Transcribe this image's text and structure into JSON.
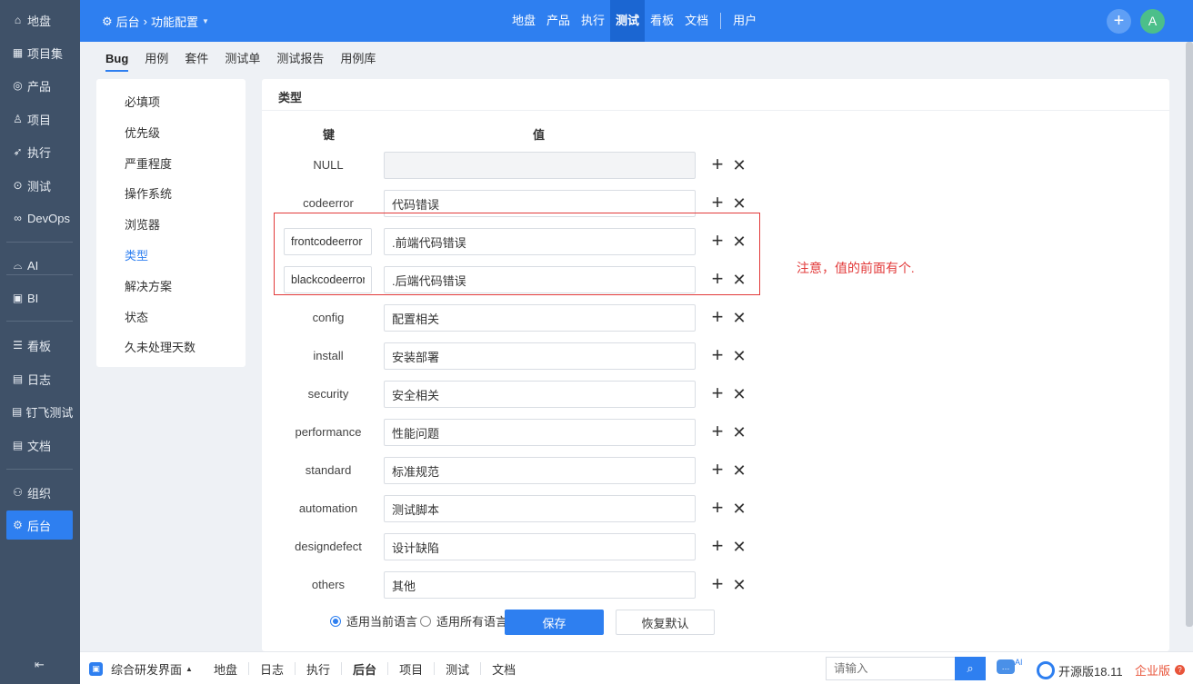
{
  "sidebar": {
    "items": [
      {
        "label": "地盘",
        "icon": "home-icon",
        "glyph": "⌂"
      },
      {
        "label": "项目集",
        "icon": "grid-icon",
        "glyph": "▦"
      },
      {
        "label": "产品",
        "icon": "location-pin-icon",
        "glyph": "◎"
      },
      {
        "label": "项目",
        "icon": "rocket-icon",
        "glyph": "♙"
      },
      {
        "label": "执行",
        "icon": "run-icon",
        "glyph": "➶"
      },
      {
        "label": "测试",
        "icon": "test-search-icon",
        "glyph": "⊙"
      },
      {
        "label": "DevOps",
        "icon": "infinity-icon",
        "glyph": "∞"
      },
      {
        "label": "AI",
        "icon": "robot-icon",
        "glyph": "⌓"
      },
      {
        "label": "BI",
        "icon": "chart-board-icon",
        "glyph": "▣"
      },
      {
        "label": "看板",
        "icon": "kanban-icon",
        "glyph": "☰"
      },
      {
        "label": "日志",
        "icon": "log-file-icon",
        "glyph": "▤"
      },
      {
        "label": "钉飞测试",
        "icon": "doc-test-icon",
        "glyph": "▤"
      },
      {
        "label": "文档",
        "icon": "document-icon",
        "glyph": "▤"
      },
      {
        "label": "组织",
        "icon": "users-icon",
        "glyph": "⚇"
      },
      {
        "label": "后台",
        "icon": "gear-icon",
        "glyph": "⚙"
      }
    ],
    "collapse_glyph": "⇤"
  },
  "topbar": {
    "crumb_module": "后台",
    "crumb_page": "功能配置",
    "nav": [
      "地盘",
      "产品",
      "执行",
      "测试",
      "看板",
      "文档"
    ],
    "nav_extra": "用户",
    "avatar_letter": "A"
  },
  "subnav": [
    "Bug",
    "用例",
    "套件",
    "测试单",
    "测试报告",
    "用例库"
  ],
  "left_menu": [
    "必填项",
    "优先级",
    "严重程度",
    "操作系统",
    "浏览器",
    "类型",
    "解决方案",
    "状态",
    "久未处理天数"
  ],
  "content": {
    "title": "类型",
    "key_header": "键",
    "value_header": "值",
    "rows": [
      {
        "key": "NULL",
        "value": "",
        "editable_key": false,
        "disabled_value": true
      },
      {
        "key": "codeerror",
        "value": "代码错误",
        "editable_key": false,
        "disabled_value": false
      },
      {
        "key": "frontcodeerror",
        "value": ".前端代码错误",
        "editable_key": true,
        "disabled_value": false
      },
      {
        "key": "blackcodeerror",
        "value": ".后端代码错误",
        "editable_key": true,
        "disabled_value": false
      },
      {
        "key": "config",
        "value": "配置相关",
        "editable_key": false,
        "disabled_value": false
      },
      {
        "key": "install",
        "value": "安装部署",
        "editable_key": false,
        "disabled_value": false
      },
      {
        "key": "security",
        "value": "安全相关",
        "editable_key": false,
        "disabled_value": false
      },
      {
        "key": "performance",
        "value": "性能问题",
        "editable_key": false,
        "disabled_value": false
      },
      {
        "key": "standard",
        "value": "标准规范",
        "editable_key": false,
        "disabled_value": false
      },
      {
        "key": "automation",
        "value": "测试脚本",
        "editable_key": false,
        "disabled_value": false
      },
      {
        "key": "designdefect",
        "value": "设计缺陷",
        "editable_key": false,
        "disabled_value": false
      },
      {
        "key": "others",
        "value": "其他",
        "editable_key": false,
        "disabled_value": false
      }
    ],
    "add_glyph": "+",
    "delete_glyph": "✕",
    "annotation": "注意，值的前面有个.",
    "radio_current": "适用当前语言",
    "radio_all": "适用所有语言",
    "save_label": "保存",
    "reset_label": "恢复默认"
  },
  "bottombar": {
    "menu_label": "综合研发界面",
    "nav": [
      "地盘",
      "日志",
      "执行",
      "后台",
      "项目",
      "测试",
      "文档"
    ],
    "search_placeholder": "请输入",
    "ai_label": "AI",
    "version": "开源版18.11",
    "enterprise": "企业版"
  },
  "colors": {
    "accent": "#2e7ff0",
    "sidebar_bg": "#3f5168",
    "annotation_red": "#e23a3a"
  }
}
